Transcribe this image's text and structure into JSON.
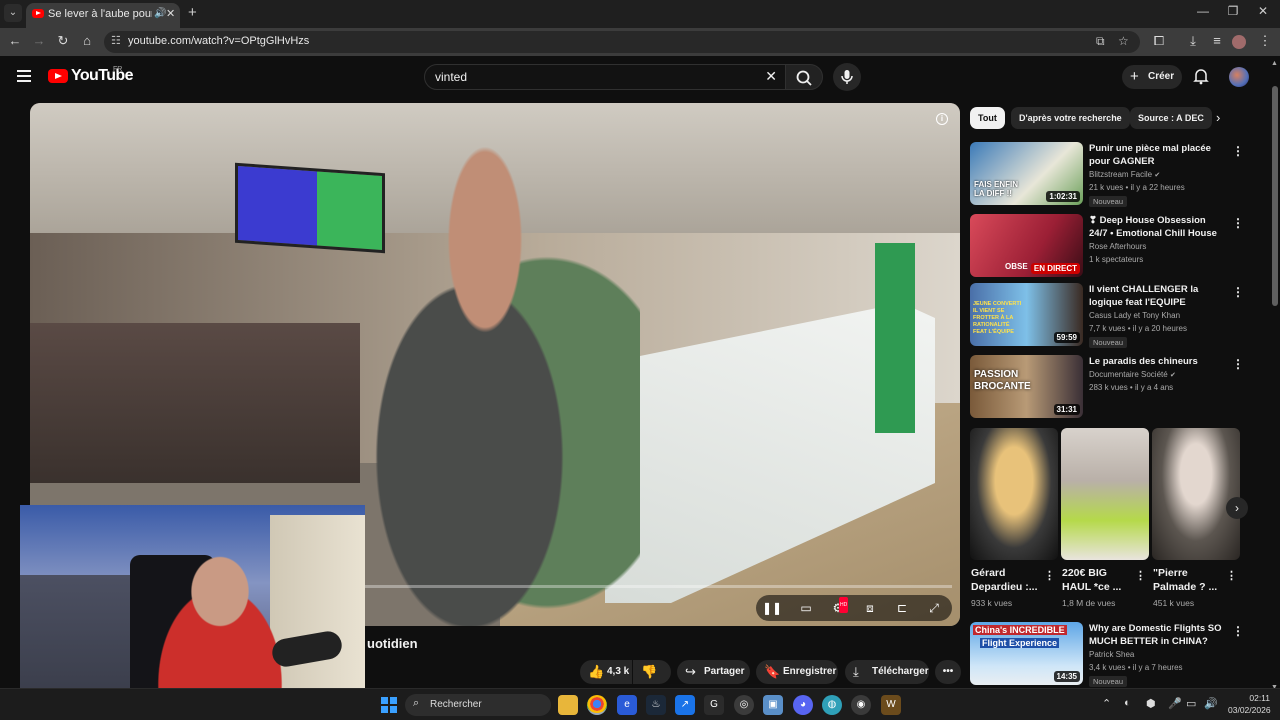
{
  "browser": {
    "tab_title": "Se lever à l'aube pour chine",
    "url": "youtube.com/watch?v=OPtgGlHvHzs"
  },
  "header": {
    "logo_text": "YouTube",
    "country": "FR",
    "search_value": "vinted",
    "create_label": "Créer"
  },
  "video": {
    "title_visible": "uotidien",
    "progress_fraction": 0.34
  },
  "actions": {
    "like_count": "4,3 k",
    "share_label": "Partager",
    "save_label": "Enregistrer",
    "download_label": "Télécharger"
  },
  "chips": [
    "Tout",
    "D'après votre recherche",
    "Source : A DEC"
  ],
  "recommendations": [
    {
      "title": "Punir une pièce mal placée pour GAGNER",
      "channel": "Blitzstream Facile",
      "meta": "21 k vues • il y a 22 heures",
      "duration": "1:02:31",
      "badge": "Nouveau",
      "thumb_text": "FAIS ENFIN LA DIFF !!"
    },
    {
      "title": "❣ Deep House Obsession 24/7 • Emotional Chill House Live ...",
      "channel": "Rose Afterhours",
      "meta": "1 k spectateurs",
      "live": "EN DIRECT",
      "thumb_text": "OBSE"
    },
    {
      "title": "Il vient CHALLENGER la logique feat l'EQUIPE",
      "channel": "Casus Lady et Tony Khan",
      "meta": "7,7 k vues • il y a 20 heures",
      "duration": "59:59",
      "badge": "Nouveau",
      "thumb_text": "JEUNE CONVERTI IL VIENT SE FROTTER À LA RATIONALITÉ FEAT L'ÉQUIPE"
    },
    {
      "title": "Le paradis des chineurs",
      "channel": "Documentaire Société",
      "meta": "283 k vues • il y a 4 ans",
      "duration": "31:31",
      "thumb_text": "PASSION BROCANTE"
    }
  ],
  "shorts": [
    {
      "title": "Gérard Depardieu :...",
      "views": "933 k vues"
    },
    {
      "title": "220€ BIG HAUL *ce ...",
      "views": "1,8 M de vues"
    },
    {
      "title": "\"Pierre Palmade ? ...",
      "views": "451 k vues"
    }
  ],
  "bottom_recommendation": {
    "title": "Why are Domestic Flights SO MUCH BETTER in CHINA?",
    "channel": "Patrick Shea",
    "meta": "3,4 k vues • il y a 7 heures",
    "duration": "14:35",
    "badge": "Nouveau",
    "thumb_line1": "China's INCREDIBLE",
    "thumb_line2": "Flight Experience"
  },
  "taskbar": {
    "search_label": "Rechercher",
    "time": "02:11",
    "date": "03/02/2026"
  }
}
